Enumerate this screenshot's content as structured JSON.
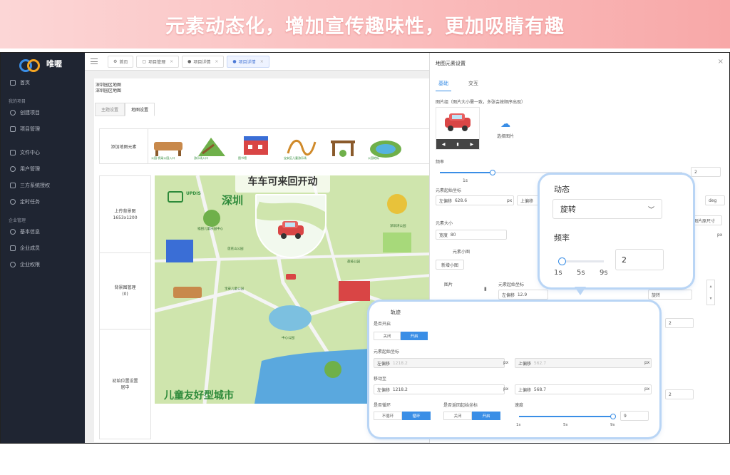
{
  "banner": {
    "text": "元素动态化，增加宣传趣味性，更加吸睛有趣"
  },
  "brand": {
    "name": "唯喔"
  },
  "sidebar": {
    "items": [
      {
        "label": "首页",
        "icon": "home-icon"
      },
      {
        "section": "我的项目"
      },
      {
        "label": "创建项目",
        "icon": "plus-circle-icon"
      },
      {
        "label": "项目管理",
        "icon": "copy-icon"
      },
      {
        "label": "文件中心",
        "icon": "folder-icon"
      },
      {
        "label": "用户管理",
        "icon": "user-icon"
      },
      {
        "label": "三方系统授权",
        "icon": "grid-icon"
      },
      {
        "label": "定时任务",
        "icon": "clock-icon"
      },
      {
        "section": "企业管理"
      },
      {
        "label": "基本信息",
        "icon": "info-icon"
      },
      {
        "label": "企业成员",
        "icon": "users-icon"
      },
      {
        "label": "企业权限",
        "icon": "power-icon"
      }
    ]
  },
  "tabs": [
    {
      "label": "首页",
      "active": false,
      "closable": false
    },
    {
      "label": "项目管理",
      "active": false,
      "closable": true
    },
    {
      "label": "项目详情",
      "active": false,
      "closable": true
    },
    {
      "label": "项目详情",
      "active": true,
      "closable": true
    }
  ],
  "project": {
    "name": "深圳园区地图",
    "subtitle": "深圳园区地图"
  },
  "subtabs": [
    {
      "label": "主题设置",
      "active": false
    },
    {
      "label": "地图设置",
      "active": true
    }
  ],
  "elements_row": {
    "label": "添加地图元素",
    "thumbs": [
      "公园 桥梁公园入口",
      "游乐场入口",
      "图书馆",
      "宝安区儿童游乐场",
      "",
      "公园地标"
    ]
  },
  "left_column": [
    {
      "label": "上传背景图\n1653x1200"
    },
    {
      "label": "背景图管理\n(0)"
    },
    {
      "label": "初始位置设置\n居中"
    }
  ],
  "map": {
    "logo": "UPDIS",
    "title": "深圳",
    "footer": "儿童友好型城市",
    "poi_labels": [
      "福田儿童乐园中心",
      "莲花山公园",
      "宝安儿童公园",
      "深圳湾公园",
      "荔枝公园",
      "中心公园"
    ]
  },
  "popup_label": "车车可来回开动",
  "panel": {
    "title": "地图元素设置",
    "tabs": [
      {
        "label": "基础",
        "active": true
      },
      {
        "label": "交互",
        "active": false
      }
    ],
    "image_group_label": "图片组（图片大小需一致，多张会按顺序出现）",
    "choose_image": "选择图片",
    "frequency_label": "频率",
    "frequency_tick": "1s",
    "frequency_value": "2",
    "origin_label": "元素起始坐标",
    "left_offset_label": "左偏移",
    "left_offset_value": "628.6",
    "top_offset_label": "上偏移",
    "px": "px",
    "deg": "deg",
    "size_label": "元素大小",
    "width_label": "宽度",
    "width_value": "80",
    "image_size_btn": "图片原尺寸",
    "mini_label": "元素小图",
    "add_mini": "新增小图",
    "image_label": "图片",
    "mini_origin_label": "元素起始坐标",
    "mini_left_value": "12.9",
    "mini_rotate": "旋转",
    "small_val": "2"
  },
  "callout_dynamic": {
    "title": "动态",
    "select_value": "旋转",
    "freq_label": "频率",
    "ticks": [
      "1s",
      "5s",
      "9s"
    ],
    "freq_value": 1,
    "input_value": "2"
  },
  "callout_track": {
    "title": "轨迹",
    "enabled_label": "是否开启",
    "enabled_options": [
      "关闭",
      "开启"
    ],
    "origin_label": "元素起始坐标",
    "left_label": "左偏移",
    "left_value": "1218.2",
    "top_label": "上偏移",
    "top_value": "562.7",
    "move_label": "移动至",
    "move_left": "1218.2",
    "move_top": "568.7",
    "px": "px",
    "loop_label": "是否循环",
    "loop_options": [
      "不循环",
      "循环"
    ],
    "return_label": "是否返回起始坐标",
    "return_options": [
      "关闭",
      "开启"
    ],
    "speed_label": "速度",
    "speed_ticks": [
      "1s",
      "5s",
      "9s"
    ],
    "speed_value": 9,
    "speed_input": "9"
  },
  "colors": {
    "accent": "#3a8ee6",
    "sidebar": "#1f2532",
    "banner_start": "#fcd6d6",
    "banner_end": "#f8a8a8"
  }
}
